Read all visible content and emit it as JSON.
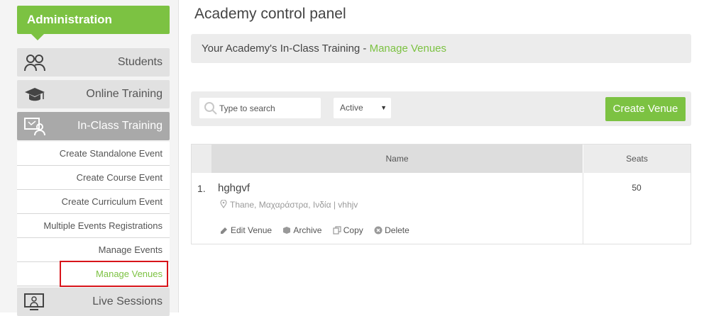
{
  "sidebar": {
    "header": "Administration",
    "items": [
      {
        "label": "Students",
        "icon": "students-icon"
      },
      {
        "label": "Online Training",
        "icon": "graduation-cap-icon"
      },
      {
        "label": "In-Class Training",
        "icon": "classroom-icon"
      },
      {
        "label": "Live Sessions",
        "icon": "live-session-icon"
      }
    ],
    "subitems": [
      "Create Standalone Event",
      "Create Course Event",
      "Create Curriculum Event",
      "Multiple Events Registrations",
      "Manage Events",
      "Manage Venues"
    ]
  },
  "main": {
    "title": "Academy control panel",
    "breadcrumb": {
      "prefix": "Your Academy's In-Class Training - ",
      "link": "Manage Venues"
    },
    "toolbar": {
      "search_placeholder": "Type to search",
      "status_value": "Active",
      "create_label": "Create Venue"
    },
    "table": {
      "headers": {
        "name": "Name",
        "seats": "Seats"
      },
      "rows": [
        {
          "number": "1.",
          "name": "hghgvf",
          "location": "Thane, Μαχαράστρα, Ινδία | vhhjv",
          "seats": "50",
          "actions": [
            "Edit Venue",
            "Archive",
            "Copy",
            "Delete"
          ]
        }
      ]
    }
  },
  "colors": {
    "accent": "#7cc242",
    "highlight": "#d8141a"
  }
}
